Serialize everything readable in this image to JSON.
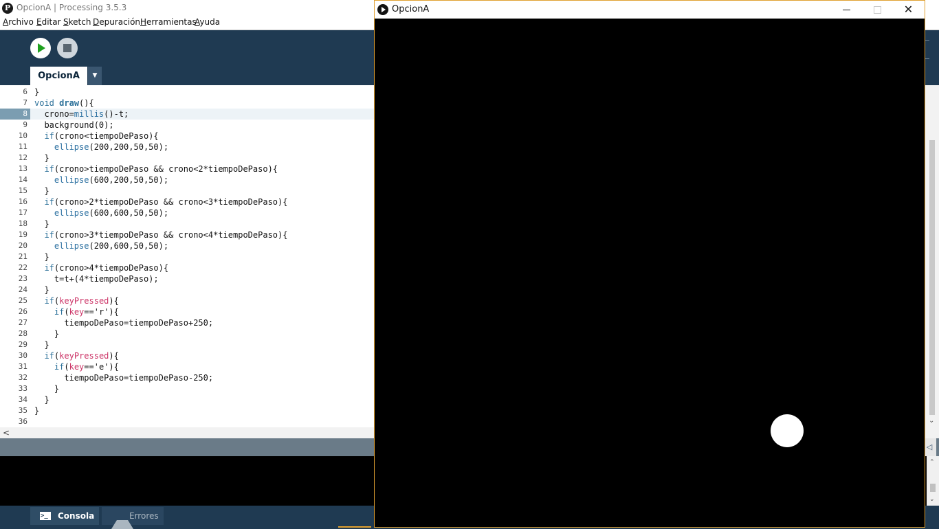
{
  "ide": {
    "window_title": "OpcionA | Processing 3.5.3",
    "logo_glyph": "P",
    "menu": [
      "Archivo",
      "Editar",
      "Sketch",
      "Depuración",
      "Herramientas",
      "Ayuda"
    ],
    "tab_label": "OpcionA",
    "tab_menu_glyph": "▼",
    "console_tab": "Consola",
    "errors_tab": "Errores",
    "scroll_left_glyph": "<",
    "scroll_down_glyph": "⌄",
    "error_arrow_glyph": "◁",
    "console_up_glyph": "⌃",
    "console_down_glyph": "⌄",
    "current_line": 8
  },
  "code_lines": [
    {
      "n": "6",
      "html": "}"
    },
    {
      "n": "7",
      "html": "<span class=\"kw\">void</span> <span class=\"fn\">draw</span>(){"
    },
    {
      "n": "8",
      "html": "  crono=<span class=\"bi\">millis</span>()-t;"
    },
    {
      "n": "9",
      "html": "  background(0);"
    },
    {
      "n": "10",
      "html": "  <span class=\"kw\">if</span>(crono&lt;tiempoDePaso){"
    },
    {
      "n": "11",
      "html": "    <span class=\"bi\">ellipse</span>(200,200,50,50);"
    },
    {
      "n": "12",
      "html": "  }"
    },
    {
      "n": "13",
      "html": "  <span class=\"kw\">if</span>(crono&gt;tiempoDePaso &amp;&amp; crono&lt;2*tiempoDePaso){"
    },
    {
      "n": "14",
      "html": "    <span class=\"bi\">ellipse</span>(600,200,50,50);"
    },
    {
      "n": "15",
      "html": "  }"
    },
    {
      "n": "16",
      "html": "  <span class=\"kw\">if</span>(crono&gt;2*tiempoDePaso &amp;&amp; crono&lt;3*tiempoDePaso){"
    },
    {
      "n": "17",
      "html": "    <span class=\"bi\">ellipse</span>(600,600,50,50);"
    },
    {
      "n": "18",
      "html": "  }"
    },
    {
      "n": "19",
      "html": "  <span class=\"kw\">if</span>(crono&gt;3*tiempoDePaso &amp;&amp; crono&lt;4*tiempoDePaso){"
    },
    {
      "n": "20",
      "html": "    <span class=\"bi\">ellipse</span>(200,600,50,50);"
    },
    {
      "n": "21",
      "html": "  }"
    },
    {
      "n": "22",
      "html": "  <span class=\"kw\">if</span>(crono&gt;4*tiempoDePaso){"
    },
    {
      "n": "23",
      "html": "    t=t+(4*tiempoDePaso);"
    },
    {
      "n": "24",
      "html": "  }"
    },
    {
      "n": "25",
      "html": "  <span class=\"kw\">if</span>(<span class=\"ev\">keyPressed</span>){"
    },
    {
      "n": "26",
      "html": "    <span class=\"kw\">if</span>(<span class=\"ev\">key</span>=='r'){"
    },
    {
      "n": "27",
      "html": "      tiempoDePaso=tiempoDePaso+250;"
    },
    {
      "n": "28",
      "html": "    }"
    },
    {
      "n": "29",
      "html": "  }"
    },
    {
      "n": "30",
      "html": "  <span class=\"kw\">if</span>(<span class=\"ev\">keyPressed</span>){"
    },
    {
      "n": "31",
      "html": "    <span class=\"kw\">if</span>(<span class=\"ev\">key</span>=='e'){"
    },
    {
      "n": "32",
      "html": "      tiempoDePaso=tiempoDePaso-250;"
    },
    {
      "n": "33",
      "html": "    }"
    },
    {
      "n": "34",
      "html": "  }"
    },
    {
      "n": "35",
      "html": "}"
    },
    {
      "n": "36",
      "html": ""
    }
  ],
  "sketch": {
    "window_title": "OpcionA",
    "close_glyph": "✕",
    "canvas_color": "#000000",
    "ball_color": "#ffffff"
  },
  "colors": {
    "ide_bg": "#1f3a52",
    "keyword": "#2b7099",
    "event_var": "#cc3366",
    "run_green": "#1ea01e"
  }
}
